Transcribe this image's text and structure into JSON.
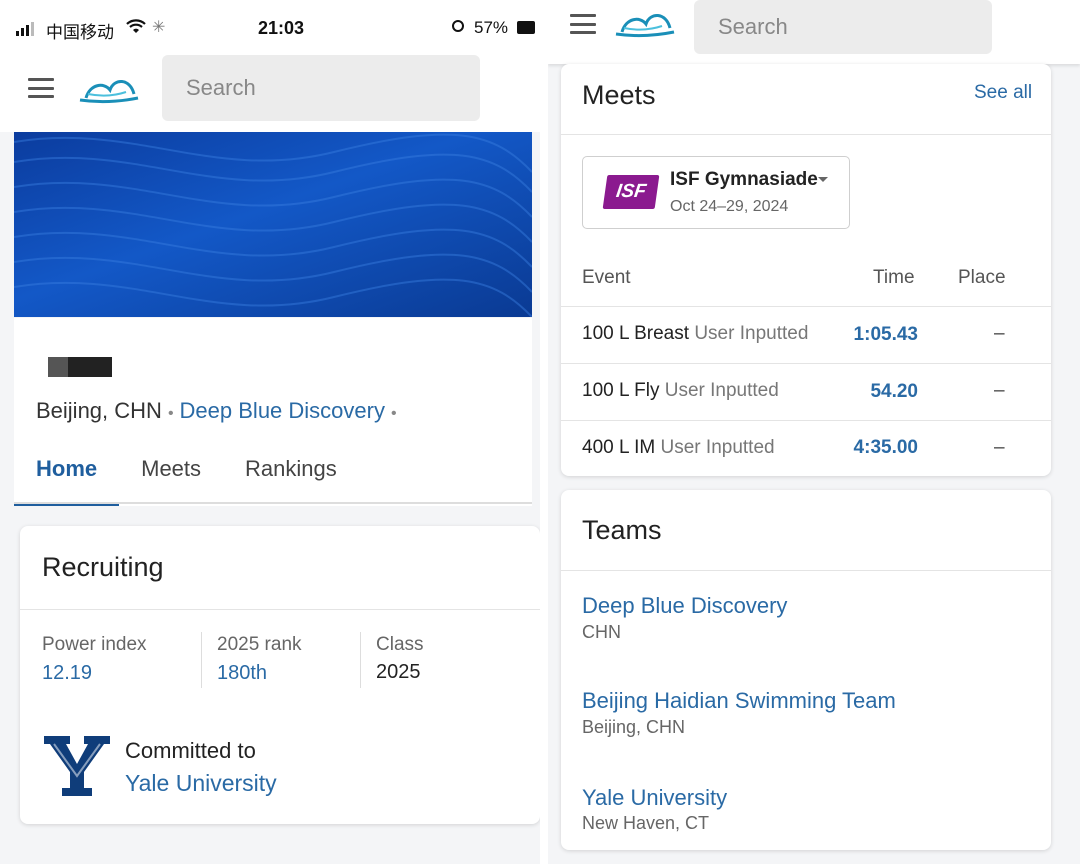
{
  "status_bar": {
    "carrier": "中国移动",
    "time": "21:03",
    "battery": "57%"
  },
  "header": {
    "search_placeholder": "Search"
  },
  "profile": {
    "location": "Beijing, CHN",
    "club": "Deep Blue Discovery",
    "tabs": [
      {
        "label": "Home"
      },
      {
        "label": "Meets"
      },
      {
        "label": "Rankings"
      }
    ]
  },
  "recruiting": {
    "title": "Recruiting",
    "stats": [
      {
        "label": "Power index",
        "value": "12.19"
      },
      {
        "label": "2025 rank",
        "value": "180th"
      },
      {
        "label": "Class",
        "value": "2025"
      }
    ],
    "committed_label": "Committed to",
    "committed_school": "Yale University",
    "logo_letter": "Y"
  },
  "meets": {
    "title": "Meets",
    "see_all": "See all",
    "selected_meet": {
      "badge": "ISF",
      "name": "ISF Gymnasiade",
      "dates": "Oct 24–29, 2024"
    },
    "columns": [
      "Event",
      "Time",
      "Place"
    ],
    "rows": [
      {
        "event": "100 L Breast",
        "source": "User Inputted",
        "time": "1:05.43",
        "place": "–"
      },
      {
        "event": "100 L Fly",
        "source": "User Inputted",
        "time": "54.20",
        "place": "–"
      },
      {
        "event": "400 L IM",
        "source": "User Inputted",
        "time": "4:35.00",
        "place": "–"
      }
    ]
  },
  "teams": {
    "title": "Teams",
    "items": [
      {
        "name": "Deep Blue Discovery",
        "location": "CHN"
      },
      {
        "name": "Beijing Haidian Swimming Team",
        "location": "Beijing, CHN"
      },
      {
        "name": "Yale University",
        "location": "New Haven, CT"
      }
    ]
  },
  "colors": {
    "link": "#2a6aa5",
    "tab_active": "#1f5e9e",
    "banner": "#1358c7",
    "isf_badge": "#8b1a8f",
    "yale_blue": "#0f3d7a"
  }
}
